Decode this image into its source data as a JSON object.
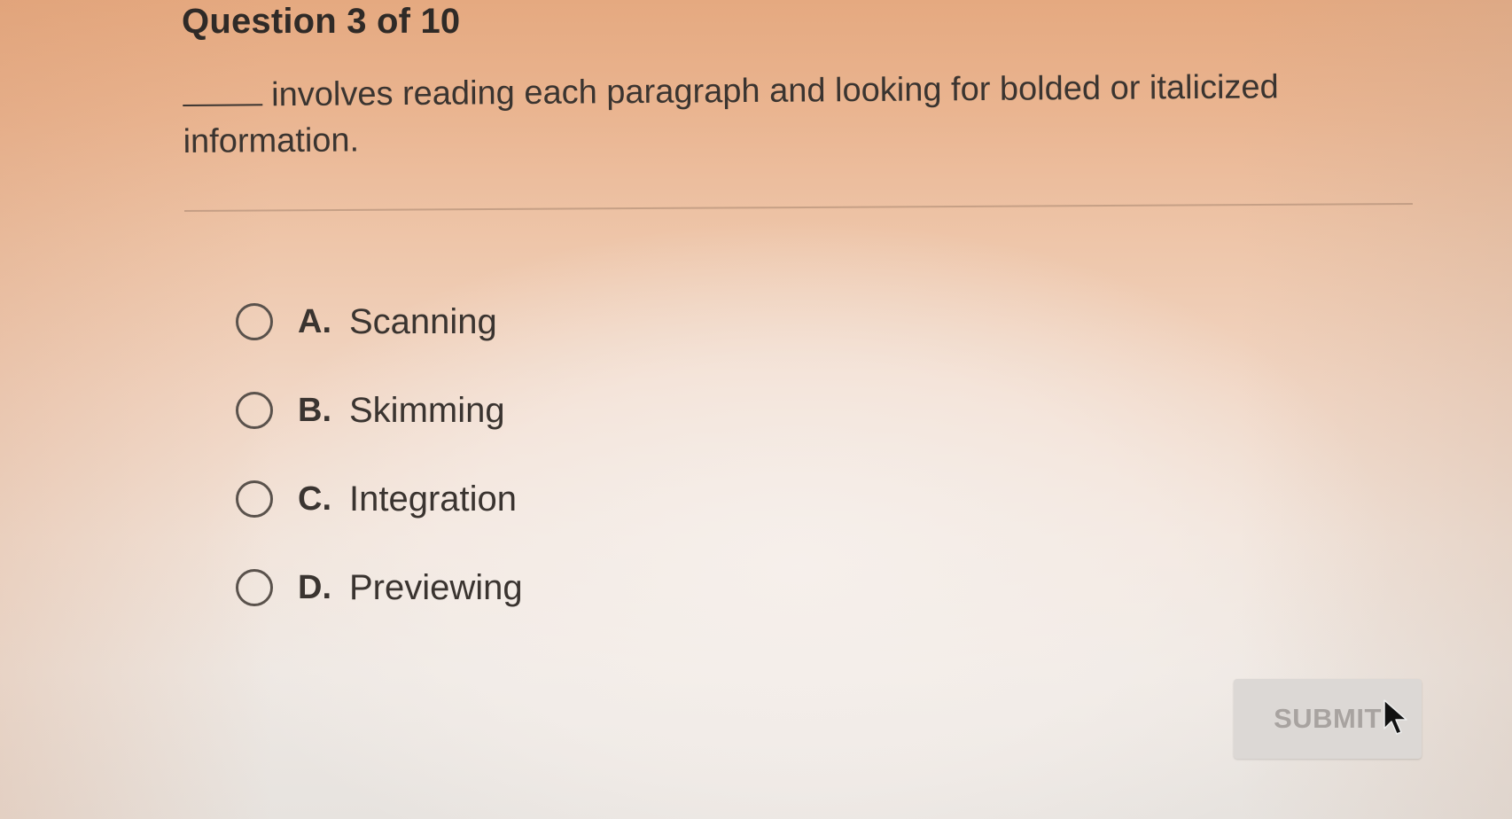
{
  "header": {
    "question_counter": "Question 3 of 10"
  },
  "question": {
    "prompt_text": "involves reading each paragraph and looking for bolded or italicized information."
  },
  "options": [
    {
      "letter": "A.",
      "text": "Scanning"
    },
    {
      "letter": "B.",
      "text": "Skimming"
    },
    {
      "letter": "C.",
      "text": "Integration"
    },
    {
      "letter": "D.",
      "text": "Previewing"
    }
  ],
  "submit": {
    "label": "SUBMIT"
  },
  "icons": {
    "radio": "radio-unselected-icon",
    "cursor": "mouse-pointer-icon"
  },
  "colors": {
    "background_top": "#e5a980",
    "background_bottom": "#e7e3df",
    "text": "#3a3430",
    "submit_bg": "#dcd8d5",
    "submit_text": "#a8a3a0"
  }
}
